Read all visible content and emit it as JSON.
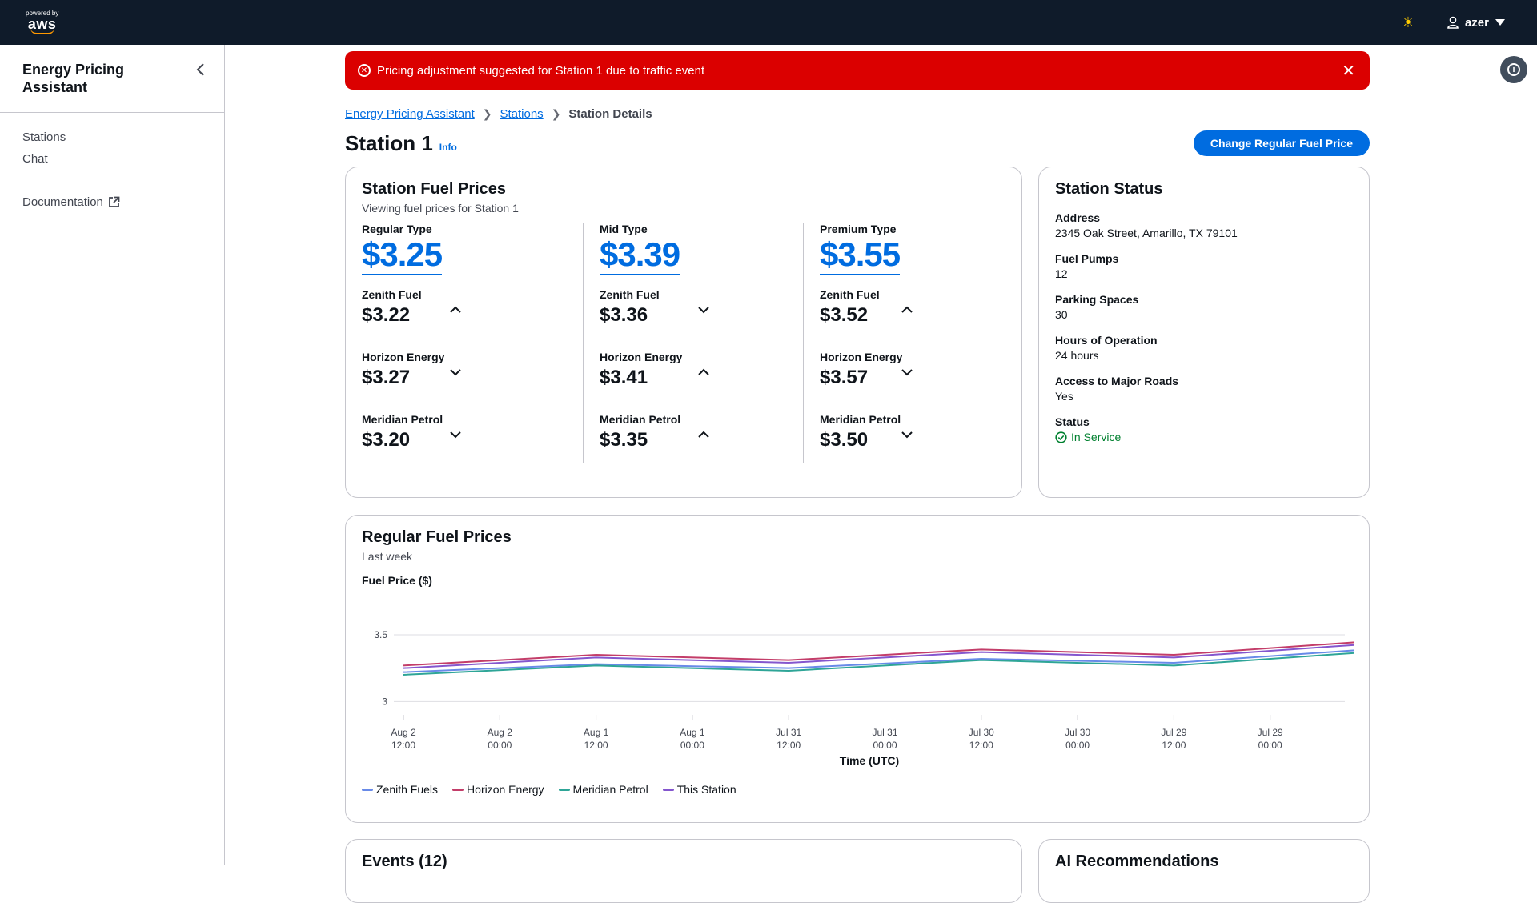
{
  "nav": {
    "logo_small": "powered by",
    "logo_main": "aws",
    "user": "azer"
  },
  "sidebar": {
    "title": "Energy Pricing Assistant",
    "items": [
      {
        "label": "Stations"
      },
      {
        "label": "Chat"
      }
    ],
    "doc_link": "Documentation"
  },
  "alert": {
    "message": "Pricing adjustment suggested for Station 1 due to traffic event"
  },
  "breadcrumb": {
    "root": "Energy Pricing Assistant",
    "stations": "Stations",
    "current": "Station Details"
  },
  "header": {
    "title": "Station 1",
    "info": "Info",
    "action": "Change Regular Fuel Price"
  },
  "fuel_prices": {
    "title": "Station Fuel Prices",
    "subtitle": "Viewing fuel prices for Station 1",
    "columns": [
      {
        "type": "Regular Type",
        "price": "$3.25",
        "competitors": [
          {
            "name": "Zenith Fuel",
            "price": "$3.22",
            "trend": "up"
          },
          {
            "name": "Horizon Energy",
            "price": "$3.27",
            "trend": "down"
          },
          {
            "name": "Meridian Petrol",
            "price": "$3.20",
            "trend": "down"
          }
        ]
      },
      {
        "type": "Mid Type",
        "price": "$3.39",
        "competitors": [
          {
            "name": "Zenith Fuel",
            "price": "$3.36",
            "trend": "down"
          },
          {
            "name": "Horizon Energy",
            "price": "$3.41",
            "trend": "up"
          },
          {
            "name": "Meridian Petrol",
            "price": "$3.35",
            "trend": "up"
          }
        ]
      },
      {
        "type": "Premium Type",
        "price": "$3.55",
        "competitors": [
          {
            "name": "Zenith Fuel",
            "price": "$3.52",
            "trend": "up"
          },
          {
            "name": "Horizon Energy",
            "price": "$3.57",
            "trend": "down"
          },
          {
            "name": "Meridian Petrol",
            "price": "$3.50",
            "trend": "down"
          }
        ]
      }
    ]
  },
  "station_status": {
    "title": "Station Status",
    "fields": [
      {
        "label": "Address",
        "value": "2345 Oak Street, Amarillo, TX 79101"
      },
      {
        "label": "Fuel Pumps",
        "value": "12"
      },
      {
        "label": "Parking Spaces",
        "value": "30"
      },
      {
        "label": "Hours of Operation",
        "value": "24 hours"
      },
      {
        "label": "Access to Major Roads",
        "value": "Yes"
      },
      {
        "label": "Status",
        "value": "In Service"
      }
    ]
  },
  "chart_card": {
    "title": "Regular Fuel Prices",
    "subtitle": "Last week"
  },
  "chart_data": {
    "type": "line",
    "ylabel": "Fuel Price ($)",
    "xlabel": "Time (UTC)",
    "ylim": [
      2.6,
      3.8
    ],
    "yticks": [
      "3.5",
      "3"
    ],
    "ytick_values": [
      3.5,
      3.0
    ],
    "categories": [
      [
        "Aug 2",
        "12:00"
      ],
      [
        "Aug 2",
        "00:00"
      ],
      [
        "Aug 1",
        "12:00"
      ],
      [
        "Aug 1",
        "00:00"
      ],
      [
        "Jul 31",
        "12:00"
      ],
      [
        "Jul 31",
        "00:00"
      ],
      [
        "Jul 30",
        "12:00"
      ],
      [
        "Jul 30",
        "00:00"
      ],
      [
        "Jul 29",
        "12:00"
      ],
      [
        "Jul 29",
        "00:00"
      ]
    ],
    "x_points": [
      0,
      2,
      4,
      6,
      8,
      10
    ],
    "series": [
      {
        "name": "Zenith Fuels",
        "color": "#688ae8",
        "values": [
          3.22,
          3.28,
          3.25,
          3.32,
          3.29,
          3.39
        ]
      },
      {
        "name": "Horizon Energy",
        "color": "#c33d69",
        "values": [
          3.27,
          3.35,
          3.31,
          3.39,
          3.35,
          3.45
        ]
      },
      {
        "name": "Meridian Petrol",
        "color": "#2ea597",
        "values": [
          3.2,
          3.27,
          3.23,
          3.31,
          3.27,
          3.37
        ]
      },
      {
        "name": "This Station",
        "color": "#8456ce",
        "values": [
          3.25,
          3.33,
          3.29,
          3.37,
          3.33,
          3.43
        ]
      }
    ]
  },
  "bottom_cards": {
    "events": "Events (12)",
    "ai": "AI Recommendations"
  },
  "colors": {
    "primary": "#006ce0",
    "alert": "#db0000",
    "nav": "#0f1b2a",
    "success": "#00802f"
  }
}
